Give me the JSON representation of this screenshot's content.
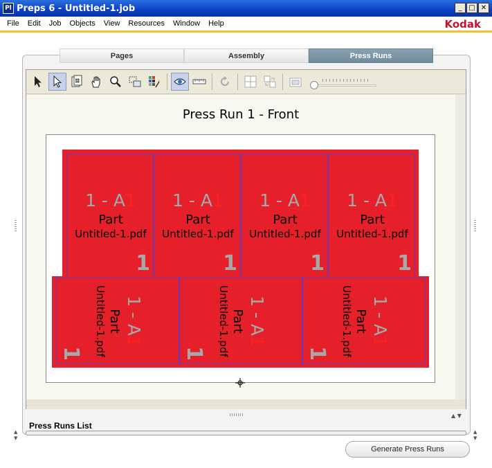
{
  "window": {
    "app_icon": "Pl",
    "title": "Preps 6 - Untitled-1.job",
    "minimize": "_",
    "maximize": "□",
    "close": "✕"
  },
  "menu": {
    "items": [
      "File",
      "Edit",
      "Job",
      "Objects",
      "View",
      "Resources",
      "Window",
      "Help"
    ],
    "logo": "Kodak"
  },
  "tabs": [
    {
      "label": "Pages",
      "active": false
    },
    {
      "label": "Assembly",
      "active": false
    },
    {
      "label": "Press Runs",
      "active": true
    }
  ],
  "toolbar": {
    "tools": [
      "arrow-icon",
      "select-arrow-icon",
      "page-number-icon",
      "hand-icon",
      "magnifier-icon",
      "marquee-icon",
      "color-grid-wand-icon",
      "eye-icon",
      "ruler-icon",
      "rotate-icon",
      "layout-icon",
      "swap-icon",
      "film-icon"
    ],
    "zoom_slider": 0
  },
  "press_run": {
    "title": "Press Run 1 - Front",
    "top_row": [
      {
        "id_main": "1 - A",
        "id_accent": "1",
        "part": "Part",
        "file": "Untitled-1.pdf",
        "num": "1"
      },
      {
        "id_main": "1 - A",
        "id_accent": "1",
        "part": "Part",
        "file": "Untitled-1.pdf",
        "num": "1"
      },
      {
        "id_main": "1 - A",
        "id_accent": "1",
        "part": "Part",
        "file": "Untitled-1.pdf",
        "num": "1"
      },
      {
        "id_main": "1 - A",
        "id_accent": "1",
        "part": "Part",
        "file": "Untitled-1.pdf",
        "num": "1"
      }
    ],
    "bottom_row": [
      {
        "id_main": "1 - A",
        "id_accent": "1",
        "part": "Part",
        "file": "Untitled-1.pdf",
        "num": "1"
      },
      {
        "id_main": "1 - A",
        "id_accent": "1",
        "part": "Part",
        "file": "Untitled-1.pdf",
        "num": "1"
      },
      {
        "id_main": "1 - A",
        "id_accent": "1",
        "part": "Part",
        "file": "Untitled-1.pdf",
        "num": "1"
      }
    ]
  },
  "list": {
    "label": "Press Runs List"
  },
  "generate_button": "Generate Press Runs",
  "colors": {
    "sheet_red": "#e5202b",
    "cell_border": "#6a3ab8",
    "active_tab": "#7a95a6",
    "kodak": "#c8102e"
  }
}
